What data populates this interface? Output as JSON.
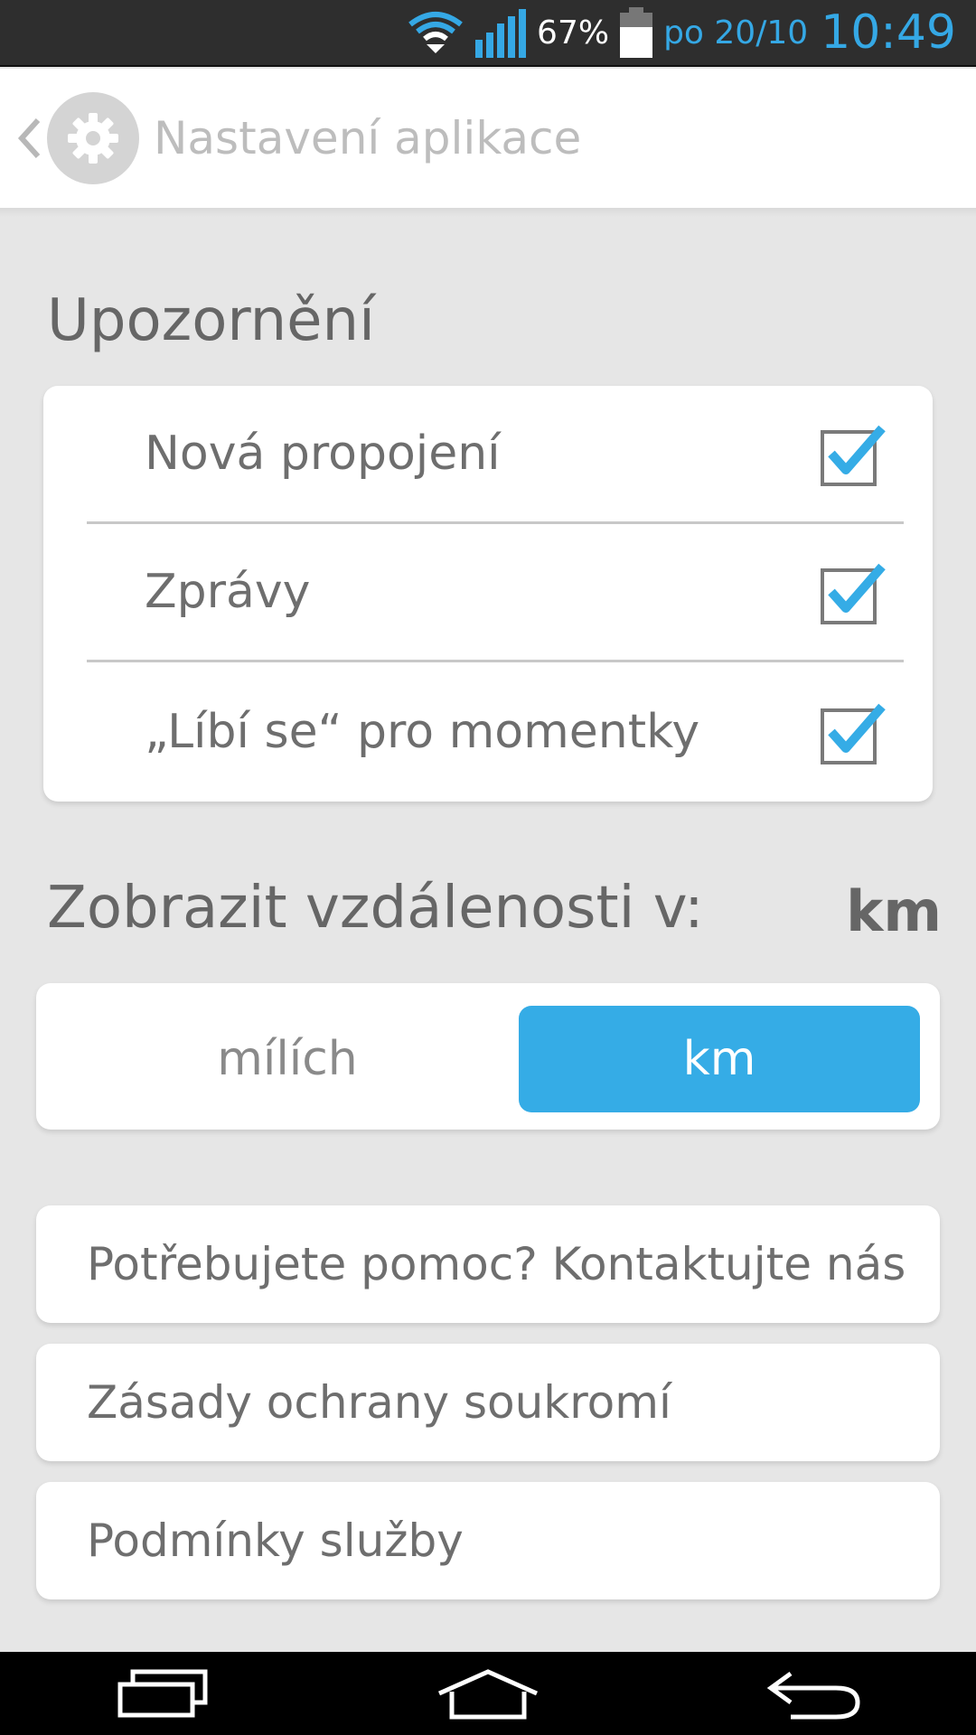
{
  "status_bar": {
    "battery_percent": "67%",
    "date": "po 20/10",
    "time": "10:49",
    "icons": [
      "wifi-icon",
      "signal-icon",
      "battery-icon"
    ]
  },
  "header": {
    "title": "Nastavení aplikace",
    "back_icon": "chevron-left-icon",
    "app_icon": "gear-icon"
  },
  "notifications": {
    "title": "Upozornění",
    "items": [
      {
        "label": "Nová propojení",
        "checked": true
      },
      {
        "label": "Zprávy",
        "checked": true
      },
      {
        "label": "„Líbí se“ pro momentky",
        "checked": true
      }
    ]
  },
  "distance": {
    "title": "Zobrazit vzdálenosti v:",
    "current_value": "km",
    "options": [
      {
        "label": "mílích",
        "selected": false
      },
      {
        "label": "km",
        "selected": true
      }
    ]
  },
  "links": [
    {
      "label": "Potřebujete pomoc? Kontaktujte nás"
    },
    {
      "label": "Zásady ochrany soukromí"
    },
    {
      "label": "Podmínky služby"
    }
  ],
  "colors": {
    "accent": "#35ace6",
    "background": "#e6e6e6",
    "card": "#ffffff",
    "status_bar": "#2e2e2e"
  }
}
